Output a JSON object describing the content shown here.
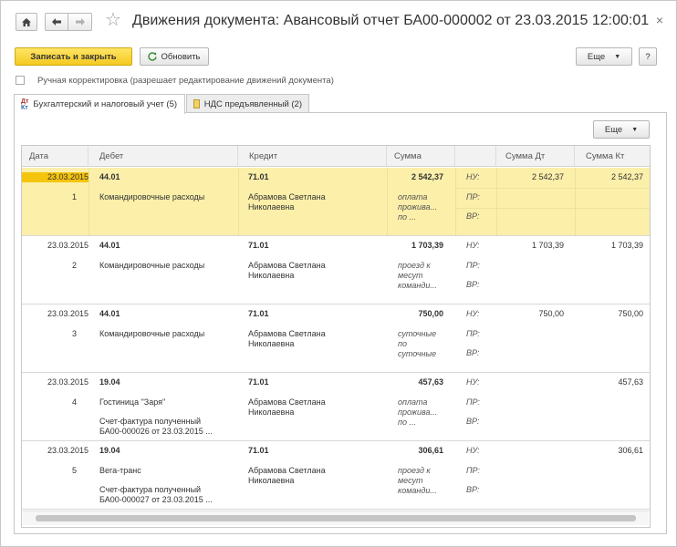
{
  "window": {
    "title": "Движения документа: Авансовый отчет БА00-000002 от 23.03.2015 12:00:01",
    "close": "×"
  },
  "toolbar": {
    "save_close": "Записать и закрыть",
    "refresh": "Обновить",
    "more": "Еще",
    "help": "?"
  },
  "manual_edit": {
    "label": "Ручная корректировка (разрешает редактирование движений документа)"
  },
  "tabs": [
    {
      "label": "Бухгалтерский и налоговый учет (5)"
    },
    {
      "label": "НДС предъявленный (2)"
    }
  ],
  "table": {
    "more": "Еще",
    "headers": {
      "date": "Дата",
      "debit": "Дебет",
      "credit": "Кредит",
      "sum": "Сумма",
      "sum_dt": "Сумма Дт",
      "sum_kt": "Сумма Кт"
    },
    "rows": [
      {
        "date": "23.03.2015",
        "num": "1",
        "debit": "44.01",
        "debit_sub1": "Командировочные расходы",
        "debit_sub2": "",
        "debit_sub3": "",
        "credit": "71.01",
        "credit_sub1": "Абрамова Светлана",
        "credit_sub2": "Николаевна",
        "sum": "2 542,37",
        "content1": "оплата",
        "content2": "прожива...",
        "content3": "по ...",
        "nu": "НУ:",
        "pr": "ПР:",
        "vr": "ВР:",
        "sum_dt": "2 542,37",
        "sum_kt": "2 542,37"
      },
      {
        "date": "23.03.2015",
        "num": "2",
        "debit": "44.01",
        "debit_sub1": "Командировочные расходы",
        "debit_sub2": "",
        "debit_sub3": "",
        "credit": "71.01",
        "credit_sub1": "Абрамова Светлана",
        "credit_sub2": "Николаевна",
        "sum": "1 703,39",
        "content1": "проезд к",
        "content2": "месут",
        "content3": "команди...",
        "nu": "НУ:",
        "pr": "ПР:",
        "vr": "ВР:",
        "sum_dt": "1 703,39",
        "sum_kt": "1 703,39"
      },
      {
        "date": "23.03.2015",
        "num": "3",
        "debit": "44.01",
        "debit_sub1": "Командировочные расходы",
        "debit_sub2": "",
        "debit_sub3": "",
        "credit": "71.01",
        "credit_sub1": "Абрамова Светлана",
        "credit_sub2": "Николаевна",
        "sum": "750,00",
        "content1": "суточные",
        "content2": "по",
        "content3": "суточные",
        "nu": "НУ:",
        "pr": "ПР:",
        "vr": "ВР:",
        "sum_dt": "750,00",
        "sum_kt": "750,00"
      },
      {
        "date": "23.03.2015",
        "num": "4",
        "debit": "19.04",
        "debit_sub1": "Гостиница \"Заря\"",
        "debit_sub2": "Счет-фактура полученный",
        "debit_sub3": "БА00-000026 от 23.03.2015 ...",
        "credit": "71.01",
        "credit_sub1": "Абрамова Светлана",
        "credit_sub2": "Николаевна",
        "sum": "457,63",
        "content1": "оплата",
        "content2": "прожива...",
        "content3": "по ...",
        "nu": "НУ:",
        "pr": "ПР:",
        "vr": "ВР:",
        "sum_dt": "",
        "sum_kt": "457,63"
      },
      {
        "date": "23.03.2015",
        "num": "5",
        "debit": "19.04",
        "debit_sub1": "Вега-транс",
        "debit_sub2": "Счет-фактура полученный",
        "debit_sub3": "БА00-000027 от 23.03.2015 ...",
        "credit": "71.01",
        "credit_sub1": "Абрамова Светлана",
        "credit_sub2": "Николаевна",
        "sum": "306,61",
        "content1": "проезд к",
        "content2": "месут",
        "content3": "команди...",
        "nu": "НУ:",
        "pr": "ПР:",
        "vr": "ВР:",
        "sum_dt": "",
        "sum_kt": "306,61"
      }
    ]
  },
  "colors": {
    "accent": "#f4c920",
    "selected_row": "#fbefa9",
    "selected_date": "#f5c40c"
  }
}
